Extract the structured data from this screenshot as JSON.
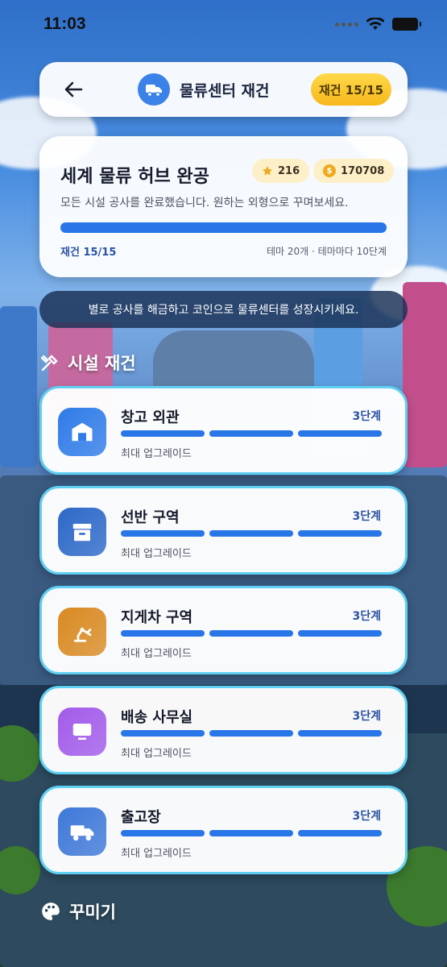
{
  "status_bar": {
    "time": "11:03"
  },
  "header": {
    "title": "물류센터 재건",
    "badge": "재건 15/15"
  },
  "completion": {
    "title": "세계 물류 허브 완공",
    "stars": "216",
    "coins": "170708",
    "subtitle": "모든 시설 공사를 완료했습니다. 원하는 외형으로 꾸며보세요.",
    "progress_fraction": 1.0,
    "progress_label": "재건 15/15",
    "meta": "테마 20개 · 테마마다 10단계"
  },
  "banner": "별로 공사를 해금하고 코인으로 물류센터를 성장시키세요.",
  "sections": {
    "rebuild": "시설 재건",
    "decorate": "꾸미기"
  },
  "facilities": [
    {
      "name": "창고 외관",
      "level": "3단계",
      "status": "최대 업그레이드",
      "icon": "warehouse-icon",
      "color": "#2f7be8"
    },
    {
      "name": "선반 구역",
      "level": "3단계",
      "status": "최대 업그레이드",
      "icon": "archive-box-icon",
      "color": "#2c68c8"
    },
    {
      "name": "지게차 구역",
      "level": "3단계",
      "status": "최대 업그레이드",
      "icon": "robot-arm-icon",
      "color": "#d98a22"
    },
    {
      "name": "배송 사무실",
      "level": "3단계",
      "status": "최대 업그레이드",
      "icon": "monitor-icon",
      "color": "#a25bea"
    },
    {
      "name": "출고장",
      "level": "3단계",
      "status": "최대 업그레이드",
      "icon": "truck-icon",
      "color": "#3e78d8"
    }
  ],
  "colors": {
    "accent": "#2876e8",
    "card_border": "#5fd0f2",
    "badge": "#f7c32e"
  }
}
